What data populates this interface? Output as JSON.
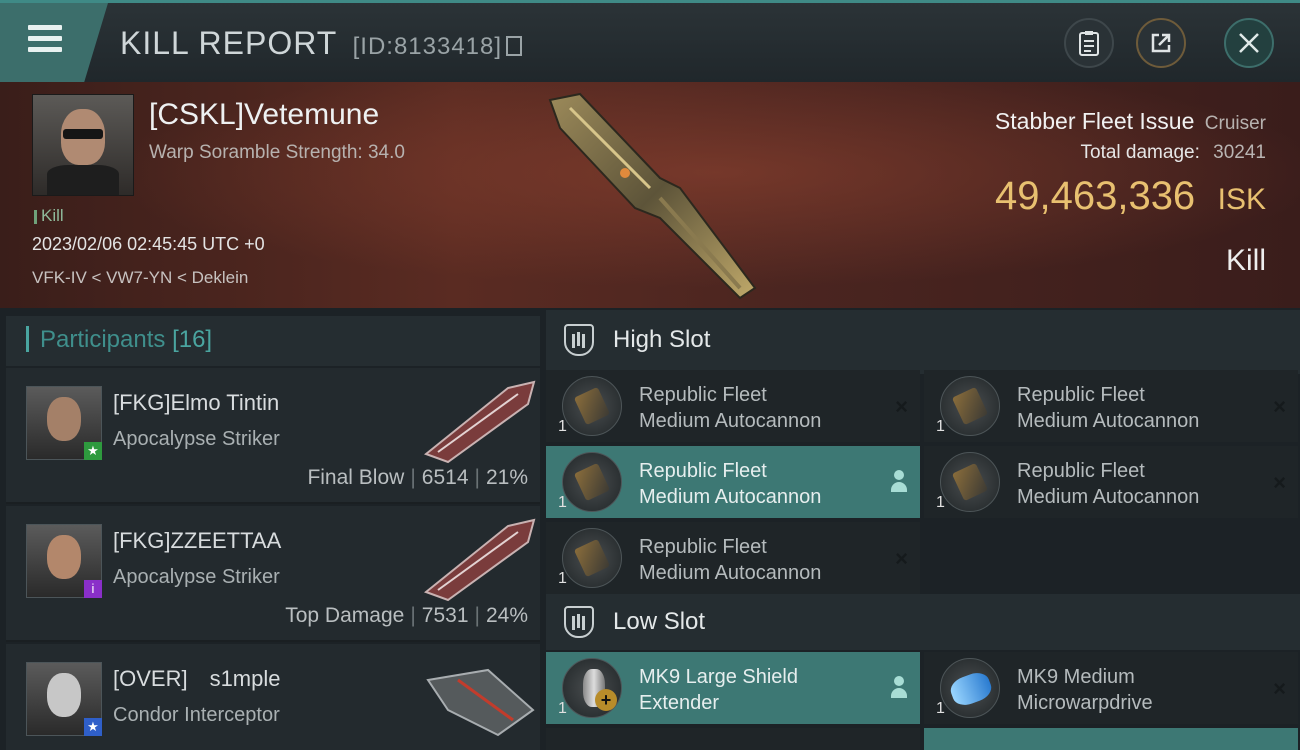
{
  "header": {
    "title": "KILL REPORT",
    "report_id": "[ID:8133418]"
  },
  "victim": {
    "name": "[CSKL]Vetemune",
    "warp_strength": "Warp Soramble Strength: 34.0",
    "tag": "Kill",
    "timestamp": "2023/02/06 02:45:45 UTC +0",
    "location": "VFK-IV < VW7-YN < Deklein",
    "ship_name": "Stabber Fleet Issue",
    "ship_class": "Cruiser",
    "total_damage_label": "Total damage:",
    "total_damage": "30241",
    "isk_value": "49,463,336",
    "isk_unit": "ISK",
    "result": "Kill"
  },
  "participants": {
    "title": "Participants",
    "count": "[16]",
    "items": [
      {
        "name": "[FKG]Elmo Tintin",
        "ship": "Apocalypse Striker",
        "role": "Final Blow",
        "damage": "6514",
        "percent": "21%",
        "badge": "★",
        "badge_color": "#2e9a3e"
      },
      {
        "name": "[FKG]ZZEETTAA",
        "ship": "Apocalypse Striker",
        "role": "Top Damage",
        "damage": "7531",
        "percent": "24%",
        "badge": "i",
        "badge_color": "#8a2fc9"
      },
      {
        "name": "[OVER] s1mple ",
        "ship": "Condor Interceptor",
        "role": "",
        "damage": "",
        "percent": "",
        "badge": "★",
        "badge_color": "#2f5fc9"
      }
    ]
  },
  "fitting": {
    "high_slot_label": "High Slot",
    "low_slot_label": "Low Slot",
    "high": [
      {
        "line1": "Republic Fleet",
        "line2": "Medium Autocannon",
        "qty": "1",
        "status": "×"
      },
      {
        "line1": "Republic Fleet",
        "line2": "Medium Autocannon",
        "qty": "1",
        "status": "×"
      },
      {
        "line1": "Republic Fleet",
        "line2": "Medium Autocannon",
        "qty": "1",
        "status": "person"
      },
      {
        "line1": "Republic Fleet",
        "line2": "Medium Autocannon",
        "qty": "1",
        "status": "×"
      },
      {
        "line1": "Republic Fleet",
        "line2": "Medium Autocannon",
        "qty": "1",
        "status": "×"
      }
    ],
    "low": [
      {
        "line1": "MK9 Large Shield",
        "line2": "Extender",
        "qty": "1",
        "status": "person"
      },
      {
        "line1": "MK9 Medium",
        "line2": "Microwarpdrive",
        "qty": "1",
        "status": "×"
      }
    ]
  },
  "colors": {
    "accent": "#3f8a86",
    "isk": "#e8c070",
    "active_module": "#3d7874"
  }
}
